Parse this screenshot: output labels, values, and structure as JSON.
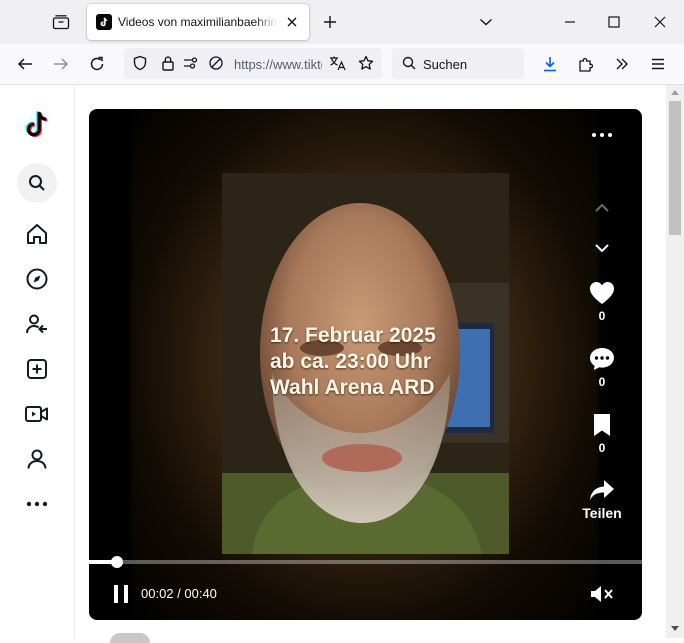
{
  "browser": {
    "tab": {
      "title": "Videos von maximilianbaehring",
      "favicon": "tiktok-icon"
    },
    "url": "https://www.tiktok.com",
    "search_placeholder": "Suchen",
    "icons": {
      "tab_list": "tab-list-icon",
      "new_tab": "plus-icon",
      "list_all_tabs": "chevron-down-icon",
      "minimize": "minimize-icon",
      "maximize": "maximize-icon",
      "close": "close-icon",
      "back": "back-arrow-icon",
      "forward": "forward-arrow-icon",
      "reload": "reload-icon",
      "shield": "shield-icon",
      "lock": "lock-icon",
      "permissions": "permissions-icon",
      "translate": "translate-icon",
      "bookmark": "star-icon",
      "downloads": "download-icon",
      "extensions": "puzzle-icon",
      "overflow": "double-chevron-icon",
      "menu": "hamburger-icon"
    }
  },
  "sidebar": {
    "items": [
      {
        "name": "tiktok-logo",
        "icon": "tiktok-logo-icon"
      },
      {
        "name": "search",
        "icon": "search-icon"
      },
      {
        "name": "home",
        "icon": "home-icon"
      },
      {
        "name": "explore",
        "icon": "compass-icon"
      },
      {
        "name": "following",
        "icon": "following-icon"
      },
      {
        "name": "upload",
        "icon": "plus-square-icon"
      },
      {
        "name": "live",
        "icon": "live-video-icon"
      },
      {
        "name": "profile",
        "icon": "profile-icon"
      },
      {
        "name": "more",
        "icon": "more-dots-icon"
      }
    ]
  },
  "video": {
    "overlay_lines": [
      "17. Februar 2025",
      "ab ca. 23:00 Uhr",
      "Wahl Arena ARD"
    ],
    "likes": "0",
    "comments": "0",
    "saves": "0",
    "share_label": "Teilen",
    "time_display": "00:02 / 00:40",
    "progress_fraction": 0.05,
    "muted": true
  },
  "colors": {
    "accent": "#fe2c55",
    "cyan": "#25f4ee",
    "chrome_bg": "#f0f0f4"
  }
}
